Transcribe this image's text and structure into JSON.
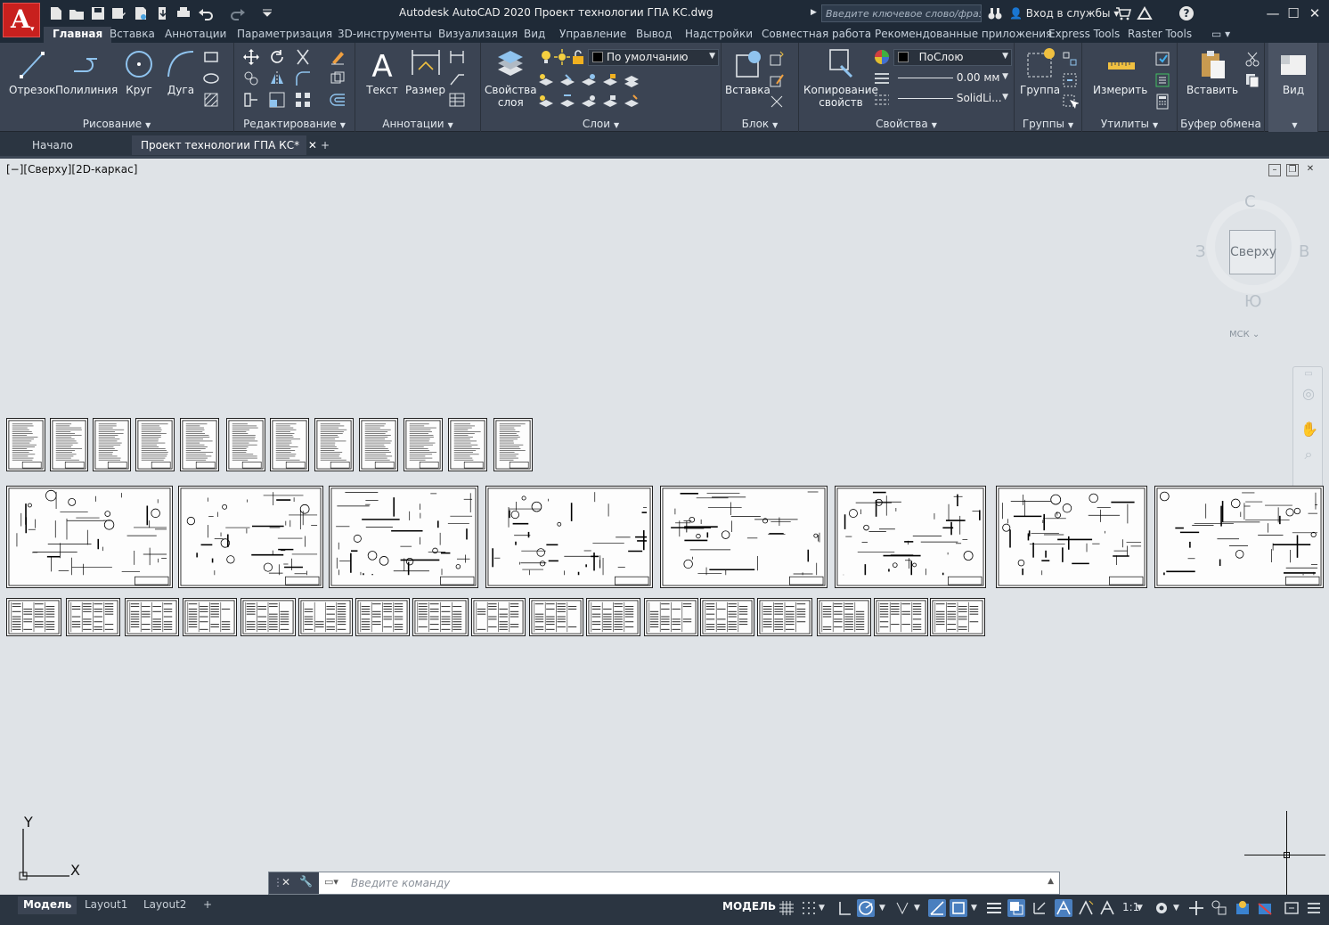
{
  "app": {
    "title": "Autodesk AutoCAD 2020   Проект технологии ГПА КС.dwg",
    "logo_letter": "A",
    "search_placeholder": "Введите ключевое слово/фразу",
    "signin": "Вход в службы",
    "accent_color": "#c8201e"
  },
  "ribbon_tabs": [
    {
      "label": "Главная",
      "active": true
    },
    {
      "label": "Вставка"
    },
    {
      "label": "Аннотации"
    },
    {
      "label": "Параметризация"
    },
    {
      "label": "3D-инструменты"
    },
    {
      "label": "Визуализация"
    },
    {
      "label": "Вид"
    },
    {
      "label": "Управление"
    },
    {
      "label": "Вывод"
    },
    {
      "label": "Надстройки"
    },
    {
      "label": "Совместная работа"
    },
    {
      "label": "Рекомендованные приложения"
    },
    {
      "label": "Express Tools"
    },
    {
      "label": "Raster Tools"
    }
  ],
  "panels": {
    "draw": {
      "title": "Рисование",
      "line": "Отрезок",
      "polyline": "Полилиния",
      "circle": "Круг",
      "arc": "Дуга"
    },
    "modify": {
      "title": "Редактирование"
    },
    "annotation": {
      "title": "Аннотации",
      "text": "Текст",
      "dimension": "Размер"
    },
    "layers": {
      "title": "Слои",
      "layer_props": "Свойства\nслоя",
      "layer_current": "По умолчанию"
    },
    "block": {
      "title": "Блок",
      "insert": "Вставка"
    },
    "properties": {
      "title": "Свойства",
      "match": "Копирование\nсвойств",
      "color": "ПоСлою",
      "lineweight": "0.00 мм",
      "linetype": "SolidLi..."
    },
    "groups": {
      "title": "Группы",
      "group": "Группа"
    },
    "utilities": {
      "title": "Утилиты",
      "measure": "Измерить"
    },
    "clipboard": {
      "title": "Буфер обмена",
      "paste": "Вставить"
    },
    "view": {
      "title": "Вид"
    }
  },
  "doc_tabs": [
    {
      "label": "Начало"
    },
    {
      "label": "Проект технологии ГПА КС*",
      "current": true
    }
  ],
  "viewport": {
    "label": "[−][Сверху][2D-каркас]",
    "viewcube": {
      "face": "Сверху",
      "north": "С",
      "south": "Ю",
      "west": "З",
      "east": "В"
    },
    "wcs": "МСК ⌄"
  },
  "ucs": {
    "x": "X",
    "y": "Y"
  },
  "command_line": {
    "placeholder": "Введите  команду"
  },
  "layout_tabs": [
    {
      "label": "Модель",
      "current": true
    },
    {
      "label": "Layout1"
    },
    {
      "label": "Layout2"
    }
  ],
  "status": {
    "model": "МОДЕЛЬ",
    "scale": "1:1"
  }
}
